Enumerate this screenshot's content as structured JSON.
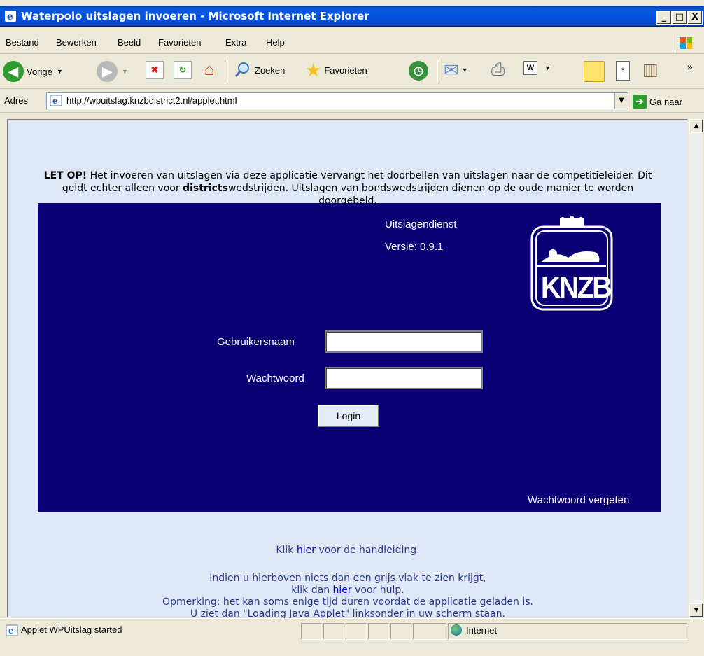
{
  "window": {
    "title": "Waterpolo uitslagen invoeren - Microsoft Internet Explorer",
    "minimize": "_",
    "maximize": "□",
    "close": "X"
  },
  "menu": {
    "items": [
      "Bestand",
      "Bewerken",
      "Beeld",
      "Favorieten",
      "Extra",
      "Help"
    ]
  },
  "toolbar": {
    "back_label": "Vorige",
    "search_label": "Zoeken",
    "favorites_label": "Favorieten",
    "chevron": "»"
  },
  "address": {
    "label": "Adres",
    "url": "http://wpuitslag.knzbdistrict2.nl/applet.html",
    "go_label": "Ga naar"
  },
  "page": {
    "notice_bold": "LET OP!",
    "notice_1": " Het invoeren van uitslagen via deze applicatie vervangt het doorbellen van uitslagen naar de competitieleider. Dit geldt echter alleen voor ",
    "notice_bold2": "districts",
    "notice_2": "wedstrijden. Uitslagen van bondswedstrijden dienen op de oude manier te worden doorgebeld.",
    "applet": {
      "service_name": "Uitslagendienst",
      "version": "Versie: 0.9.1",
      "logo_text": "KNZB",
      "username_label": "Gebruikersnaam",
      "username_value": "",
      "password_label": "Wachtwoord",
      "password_value": "",
      "login_label": "Login",
      "forgot_label": "Wachtwoord vergeten"
    },
    "footer": {
      "manual_pre": "Klik ",
      "manual_link": "hier",
      "manual_post": " voor de handleiding.",
      "help_line1": "Indien u hierboven niets dan een grijs vlak te zien krijgt,",
      "help_pre": "klik dan ",
      "help_link": "hier",
      "help_post": " voor hulp.",
      "remark_line1": "Opmerking: het kan soms enige tijd duren voordat de applicatie geladen is.",
      "remark_line2": "U ziet dan \"Loading Java Applet\" linksonder in uw scherm staan."
    }
  },
  "status": {
    "text": "Applet WPUitslag started",
    "zone": "Internet"
  }
}
